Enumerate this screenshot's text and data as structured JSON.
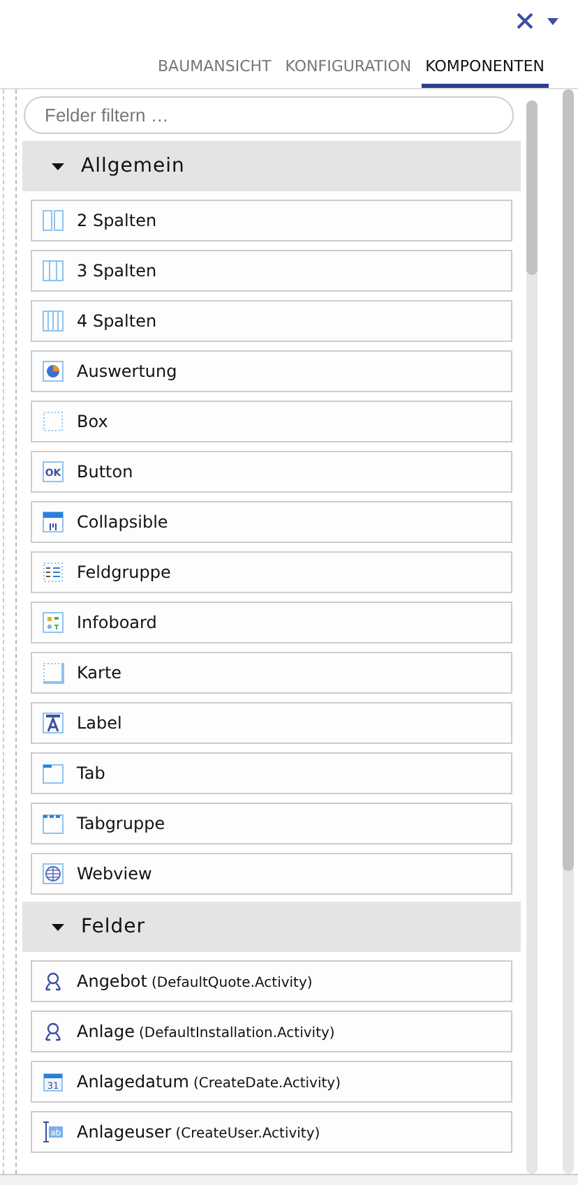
{
  "tabs": [
    {
      "label": "BAUMANSICHT",
      "selected": false
    },
    {
      "label": "KONFIGURATION",
      "selected": false
    },
    {
      "label": "KOMPONENTEN",
      "selected": true
    }
  ],
  "filter": {
    "placeholder": "Felder filtern …"
  },
  "sections": [
    {
      "title": "Allgemein",
      "expanded": true,
      "items": [
        {
          "label": "2 Spalten",
          "kind": "cols2"
        },
        {
          "label": "3 Spalten",
          "kind": "cols3"
        },
        {
          "label": "4 Spalten",
          "kind": "cols4"
        },
        {
          "label": "Auswertung",
          "kind": "chart"
        },
        {
          "label": "Box",
          "kind": "box"
        },
        {
          "label": "Button",
          "kind": "button",
          "icon_text": "OK"
        },
        {
          "label": "Collapsible",
          "kind": "collapsible"
        },
        {
          "label": "Feldgruppe",
          "kind": "fieldgroup"
        },
        {
          "label": "Infoboard",
          "kind": "infoboard"
        },
        {
          "label": "Karte",
          "kind": "card"
        },
        {
          "label": "Label",
          "kind": "label"
        },
        {
          "label": "Tab",
          "kind": "tab"
        },
        {
          "label": "Tabgruppe",
          "kind": "tabgroup"
        },
        {
          "label": "Webview",
          "kind": "web"
        }
      ]
    },
    {
      "title": "Felder",
      "expanded": true,
      "items": [
        {
          "label": "Angebot",
          "detail": "(DefaultQuote.Activity)",
          "kind": "person"
        },
        {
          "label": "Anlage",
          "detail": "(DefaultInstallation.Activity)",
          "kind": "person"
        },
        {
          "label": "Anlagedatum",
          "detail": "(CreateDate.Activity)",
          "kind": "date",
          "icon_text": "31"
        },
        {
          "label": "Anlageuser",
          "detail": "(CreateUser.Activity)",
          "kind": "text",
          "icon_text": "ab"
        }
      ]
    }
  ]
}
